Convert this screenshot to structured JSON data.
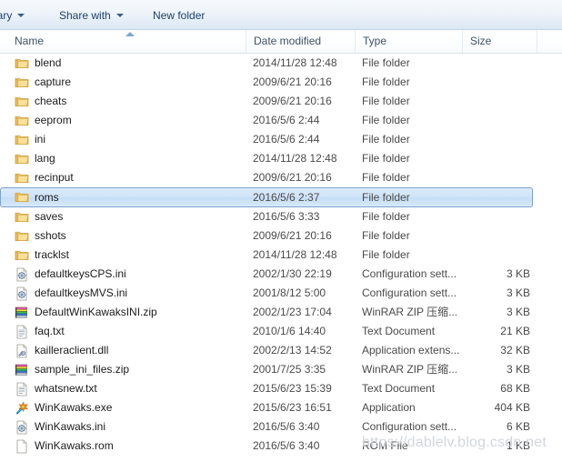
{
  "toolbar": {
    "library_label": "brary",
    "share_label": "Share with",
    "new_folder_label": "New folder"
  },
  "columns": {
    "name": "Name",
    "date_modified": "Date modified",
    "type": "Type",
    "size": "Size",
    "sort_icon": "sort-ascending-icon",
    "sort_column": "Name"
  },
  "colors": {
    "selection_border": "#7da2ce",
    "selection_fill": "#cfe3f8",
    "toolbar_text": "#20406b",
    "header_text": "#3d5265",
    "folder_icon": "#f4c65a"
  },
  "files": [
    {
      "name": "blend",
      "date": "2014/11/28 12:48",
      "type": "File folder",
      "size": "",
      "icon": "folder-icon",
      "selected": false
    },
    {
      "name": "capture",
      "date": "2009/6/21 20:16",
      "type": "File folder",
      "size": "",
      "icon": "folder-icon",
      "selected": false
    },
    {
      "name": "cheats",
      "date": "2009/6/21 20:16",
      "type": "File folder",
      "size": "",
      "icon": "folder-icon",
      "selected": false
    },
    {
      "name": "eeprom",
      "date": "2016/5/6 2:44",
      "type": "File folder",
      "size": "",
      "icon": "folder-icon",
      "selected": false
    },
    {
      "name": "ini",
      "date": "2016/5/6 2:44",
      "type": "File folder",
      "size": "",
      "icon": "folder-icon",
      "selected": false
    },
    {
      "name": "lang",
      "date": "2014/11/28 12:48",
      "type": "File folder",
      "size": "",
      "icon": "folder-icon",
      "selected": false
    },
    {
      "name": "recinput",
      "date": "2009/6/21 20:16",
      "type": "File folder",
      "size": "",
      "icon": "folder-icon",
      "selected": false
    },
    {
      "name": "roms",
      "date": "2016/5/6 2:37",
      "type": "File folder",
      "size": "",
      "icon": "folder-icon",
      "selected": true
    },
    {
      "name": "saves",
      "date": "2016/5/6 3:33",
      "type": "File folder",
      "size": "",
      "icon": "folder-icon",
      "selected": false
    },
    {
      "name": "sshots",
      "date": "2009/6/21 20:16",
      "type": "File folder",
      "size": "",
      "icon": "folder-icon",
      "selected": false
    },
    {
      "name": "tracklst",
      "date": "2014/11/28 12:48",
      "type": "File folder",
      "size": "",
      "icon": "folder-icon",
      "selected": false
    },
    {
      "name": "defaultkeysCPS.ini",
      "date": "2002/1/30 22:19",
      "type": "Configuration sett...",
      "size": "3 KB",
      "icon": "ini-file-icon",
      "selected": false
    },
    {
      "name": "defaultkeysMVS.ini",
      "date": "2001/8/12 5:00",
      "type": "Configuration sett...",
      "size": "3 KB",
      "icon": "ini-file-icon",
      "selected": false
    },
    {
      "name": "DefaultWinKawaksINI.zip",
      "date": "2002/1/23 17:04",
      "type": "WinRAR ZIP 压缩...",
      "size": "3 KB",
      "icon": "zip-archive-icon",
      "selected": false
    },
    {
      "name": "faq.txt",
      "date": "2010/1/6 14:40",
      "type": "Text Document",
      "size": "21 KB",
      "icon": "text-file-icon",
      "selected": false
    },
    {
      "name": "kailleraclient.dll",
      "date": "2002/2/13 14:52",
      "type": "Application extens...",
      "size": "32 KB",
      "icon": "dll-file-icon",
      "selected": false
    },
    {
      "name": "sample_ini_files.zip",
      "date": "2001/7/25 3:35",
      "type": "WinRAR ZIP 压缩...",
      "size": "3 KB",
      "icon": "zip-archive-icon",
      "selected": false
    },
    {
      "name": "whatsnew.txt",
      "date": "2015/6/23 15:39",
      "type": "Text Document",
      "size": "68 KB",
      "icon": "text-file-icon",
      "selected": false
    },
    {
      "name": "WinKawaks.exe",
      "date": "2015/6/23 16:51",
      "type": "Application",
      "size": "404 KB",
      "icon": "application-icon",
      "selected": false
    },
    {
      "name": "WinKawaks.ini",
      "date": "2016/5/6 3:40",
      "type": "Configuration sett...",
      "size": "6 KB",
      "icon": "ini-file-icon",
      "selected": false
    },
    {
      "name": "WinKawaks.rom",
      "date": "2016/5/6 3:40",
      "type": "ROM File",
      "size": "1 KB",
      "icon": "blank-file-icon",
      "selected": false
    }
  ],
  "watermark": {
    "text": "https://dablelv.blog.csdn.net"
  }
}
